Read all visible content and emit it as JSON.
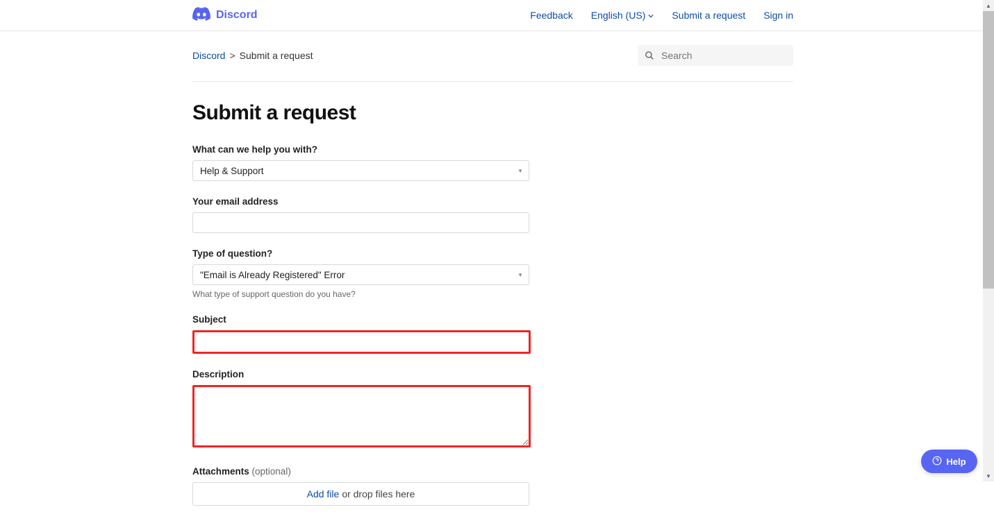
{
  "brand": {
    "name": "Discord"
  },
  "nav": {
    "feedback": "Feedback",
    "language": "English (US)",
    "submit_request": "Submit a request",
    "sign_in": "Sign in"
  },
  "breadcrumb": {
    "root": "Discord",
    "separator": ">",
    "current": "Submit a request"
  },
  "search": {
    "placeholder": "Search"
  },
  "page": {
    "title": "Submit a request"
  },
  "form": {
    "help_with": {
      "label": "What can we help you with?",
      "value": "Help & Support"
    },
    "email": {
      "label": "Your email address",
      "value": ""
    },
    "question_type": {
      "label": "Type of question?",
      "value": "\"Email is Already Registered\" Error",
      "hint": "What type of support question do you have?"
    },
    "subject": {
      "label": "Subject",
      "value": ""
    },
    "description": {
      "label": "Description",
      "value": ""
    },
    "attachments": {
      "label": "Attachments",
      "optional": "(optional)",
      "add_file": "Add file",
      "drop_text": "or drop files here"
    }
  },
  "help_widget": {
    "label": "Help"
  }
}
